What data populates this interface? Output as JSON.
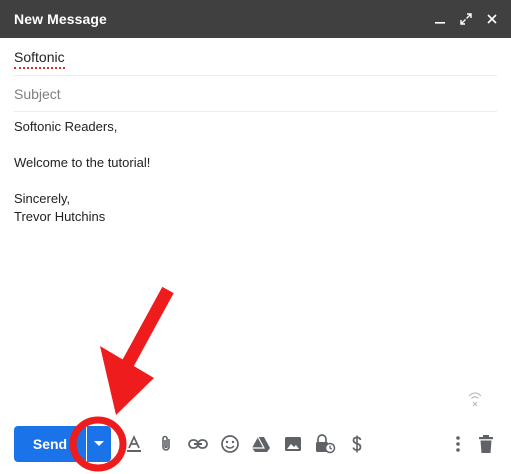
{
  "window": {
    "title": "New Message"
  },
  "compose": {
    "to": "Softonic",
    "subject_placeholder": "Subject",
    "body": {
      "greeting": "Softonic Readers,",
      "message": "Welcome to the tutorial!",
      "closing": "Sincerely,",
      "signature": "Trevor Hutchins"
    }
  },
  "toolbar": {
    "send_label": "Send",
    "icons": [
      "dropdown-caret-icon",
      "text-format-icon",
      "paperclip-icon",
      "link-icon",
      "emoji-icon",
      "drive-icon",
      "photo-icon",
      "confidential-icon",
      "dollar-icon",
      "more-vert-icon",
      "trash-icon"
    ]
  },
  "colors": {
    "title_bar": "#404040",
    "send_button": "#1a73e8",
    "annotation": "#ee1c1c"
  }
}
